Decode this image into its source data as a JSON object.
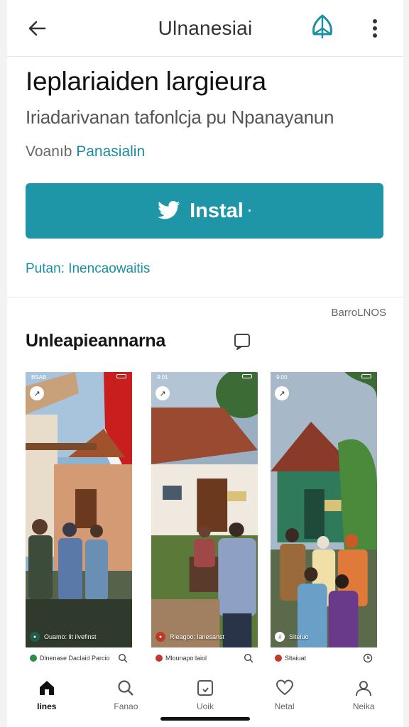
{
  "header": {
    "title": "Ulnanesiai"
  },
  "app": {
    "name": "Ieplariaiden largieura",
    "subtitle": "Iriadarivanan tafonlcja pu Npanayanun",
    "developer_prefix": "Voanıb",
    "developer_name": "Panasialin",
    "install_label": "Instal",
    "install_trail": "·",
    "policy_text": "Putan: Inencaowaitis"
  },
  "section": {
    "title": "Unleapieannarna",
    "right_link": "BarroLNOS"
  },
  "screenshots": [
    {
      "caption": "Ouamo: lit ilvefinst",
      "bar_text": "Dlnenase Daclaid Parcio",
      "dot_color": "#2c8c4a"
    },
    {
      "caption": "Rieagoo: lanesanst",
      "bar_text": "Mlounapo:laiol",
      "dot_color": "#c0392b"
    },
    {
      "caption": "Siteiuo",
      "bar_text": "Sltaiuat",
      "dot_color": "#c0392b"
    }
  ],
  "status_bar": {
    "time_1": "BSAB",
    "time_2": "9:01",
    "time_3": "9:00"
  },
  "nav": [
    {
      "label": "Iines",
      "icon": "home-icon",
      "active": true
    },
    {
      "label": "Fanao",
      "icon": "search-icon",
      "active": false
    },
    {
      "label": "Uoik",
      "icon": "apps-icon",
      "active": false
    },
    {
      "label": "Netal",
      "icon": "heart-icon",
      "active": false
    },
    {
      "label": "Neika",
      "icon": "profile-icon",
      "active": false
    }
  ],
  "colors": {
    "accent": "#1f96a8",
    "link": "#1a8ea2"
  }
}
